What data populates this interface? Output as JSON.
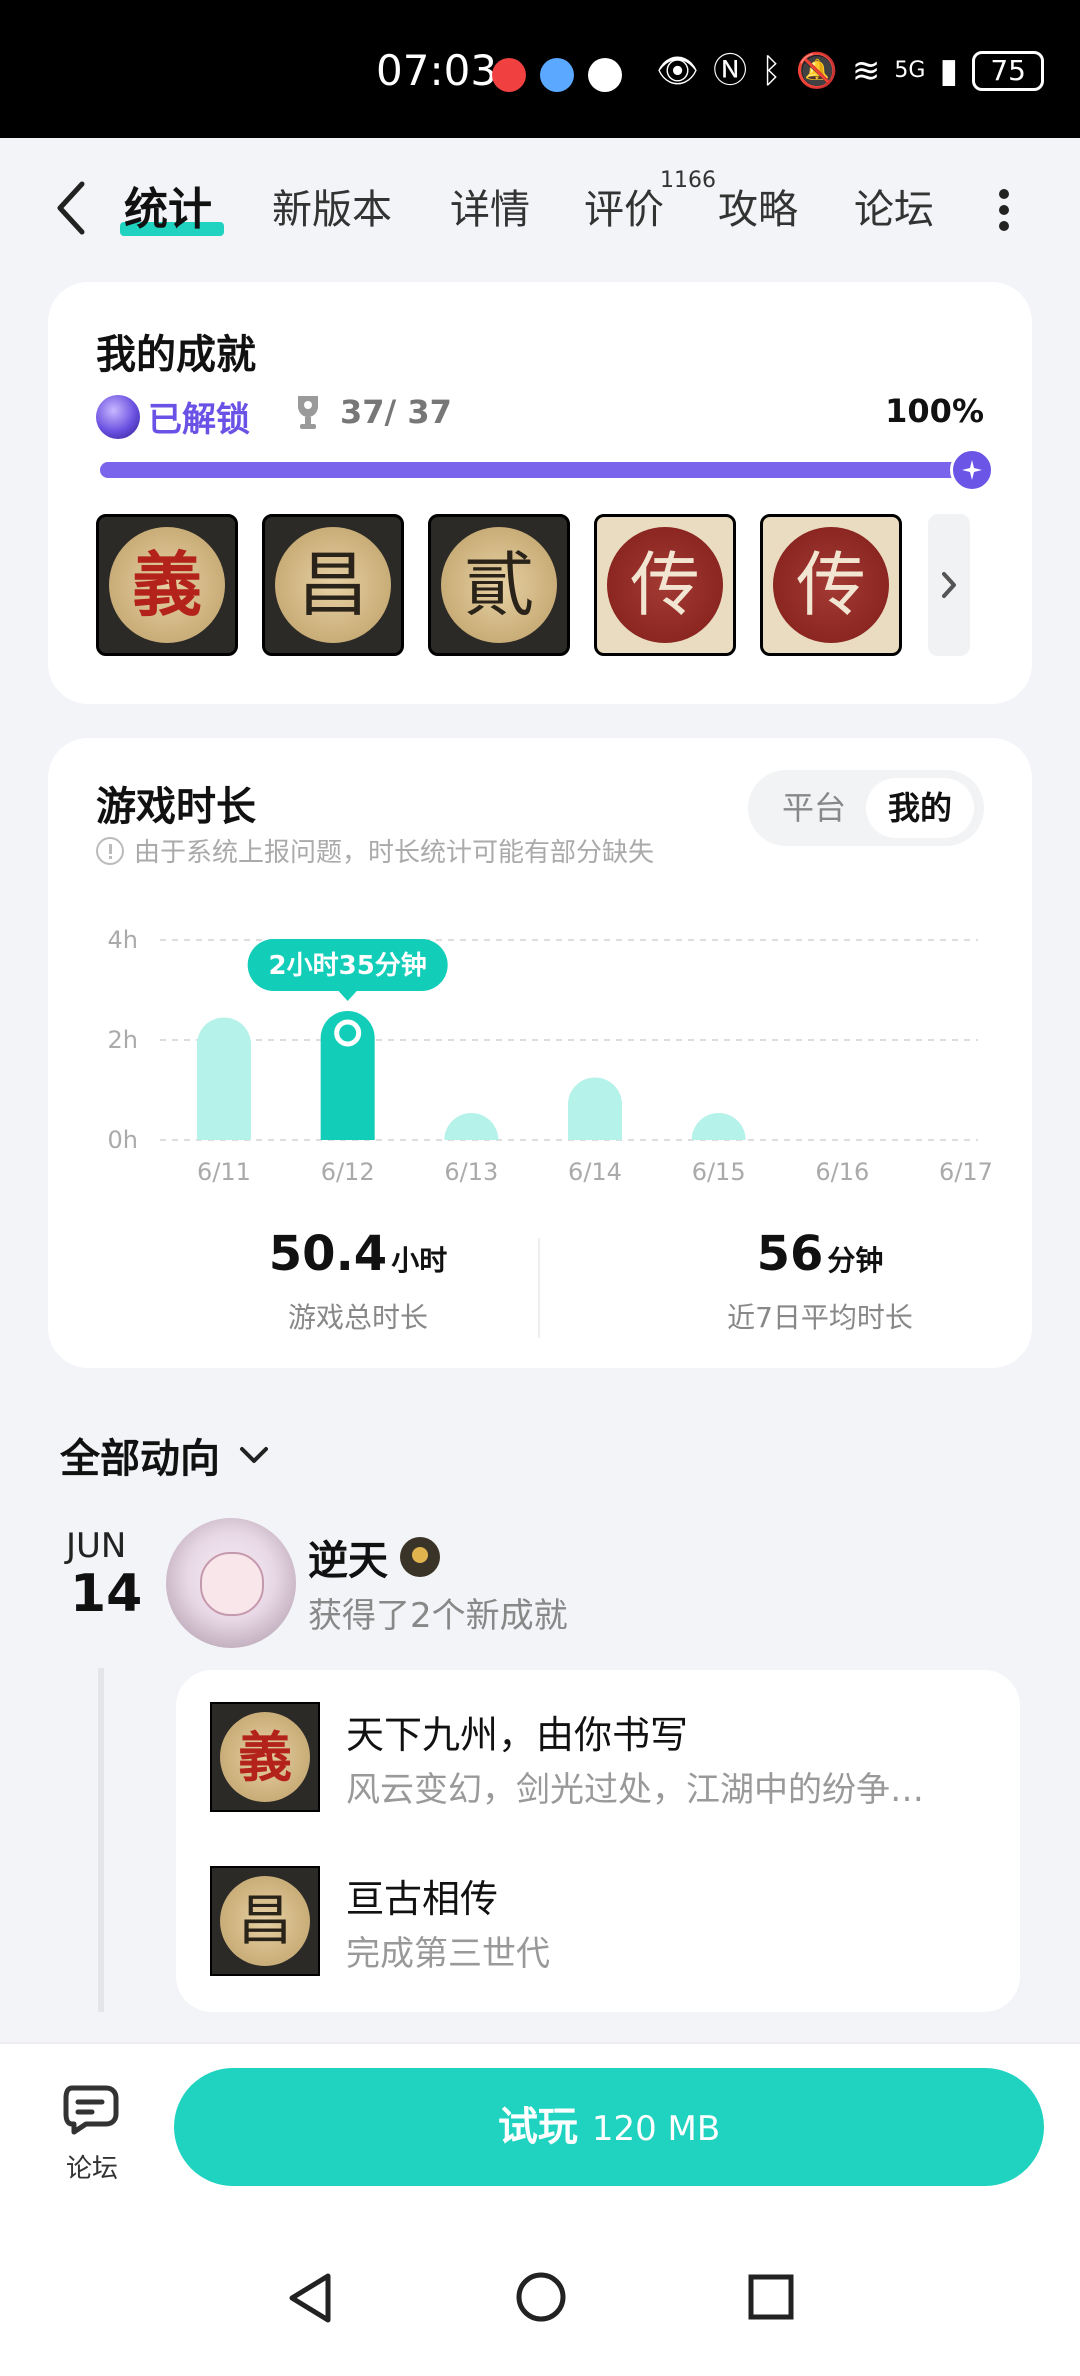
{
  "status_bar": {
    "time": "07:03",
    "network": "5G",
    "battery": "75",
    "icons": [
      "app-red-icon",
      "app-blue-icon",
      "cctv-icon",
      "eye-icon",
      "nfc-icon",
      "bluetooth-icon",
      "mute-icon",
      "wifi-icon",
      "signal-icon",
      "battery-icon"
    ]
  },
  "nav": {
    "tabs": [
      {
        "label": "统计",
        "active": true
      },
      {
        "label": "新版本"
      },
      {
        "label": "详情"
      },
      {
        "label": "评价"
      },
      {
        "label": "攻略"
      },
      {
        "label": "论坛"
      }
    ],
    "review_count": "1166"
  },
  "achievements": {
    "title": "我的成就",
    "unlocked_label": "已解锁",
    "count": "37/ 37",
    "percent_text": "100%",
    "progress": 1.0,
    "badges": [
      {
        "glyph": "義",
        "style": "red"
      },
      {
        "glyph": "昌",
        "style": "dark"
      },
      {
        "glyph": "貳",
        "style": "dark"
      },
      {
        "glyph": "传",
        "style": "light"
      },
      {
        "glyph": "传",
        "style": "light"
      }
    ]
  },
  "playtime": {
    "title": "游戏时长",
    "notice": "由于系统上报问题，时长统计可能有部分缺失",
    "toggle": {
      "platform": "平台",
      "mine": "我的",
      "selected": "我的"
    },
    "total": {
      "value": "50.4",
      "unit": "小时",
      "label": "游戏总时长"
    },
    "average": {
      "value": "56",
      "unit": "分钟",
      "label": "近7日平均时长"
    }
  },
  "chart_data": {
    "type": "bar",
    "categories": [
      "6/11",
      "6/12",
      "6/13",
      "6/14",
      "6/15",
      "6/16",
      "6/17"
    ],
    "values": [
      2.45,
      2.58,
      0.3,
      1.25,
      0.2,
      0,
      0
    ],
    "y_ticks": [
      "0h",
      "2h",
      "4h"
    ],
    "ylim": [
      0,
      4
    ],
    "highlight_index": 1,
    "tooltip": "2小时35分钟",
    "grid": true,
    "colors": {
      "bar": "#b4f2ea",
      "highlight": "#12cdb8"
    }
  },
  "feed": {
    "title": "全部动向",
    "date_month": "JUN",
    "date_day": "14",
    "user_name": "逆天",
    "action": "获得了2个新成就",
    "items": [
      {
        "title": "天下九州，由你书写",
        "desc": "风云变幻，剑光过处，江湖中的纷争…",
        "glyph": "義"
      },
      {
        "title": "亘古相传",
        "desc": "完成第三世代",
        "glyph": "昌"
      }
    ]
  },
  "bottom": {
    "forum_label": "论坛",
    "trial_label": "试玩",
    "trial_size": "120 MB"
  },
  "colors": {
    "accent": "#1fd3c0",
    "purple": "#6b55e6"
  }
}
